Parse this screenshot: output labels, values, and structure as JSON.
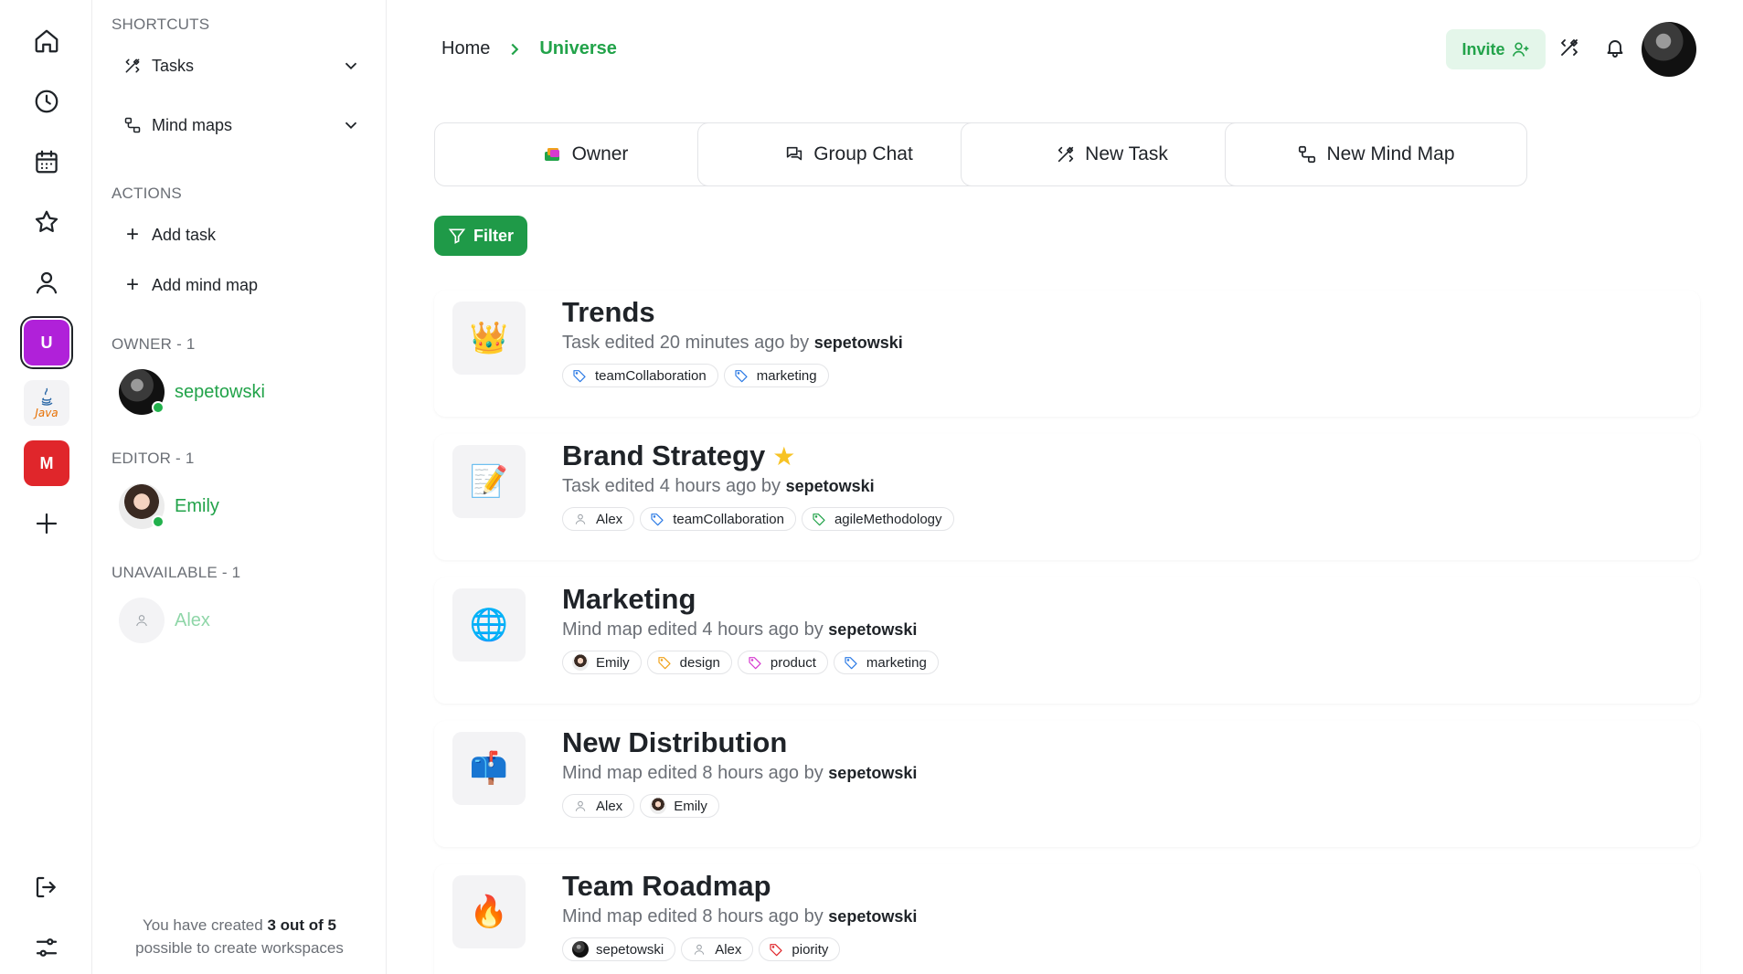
{
  "rail": {
    "nav_icons": [
      "home-icon",
      "clock-icon",
      "calendar-icon",
      "star-icon",
      "user-icon"
    ],
    "workspaces": [
      {
        "label": "U",
        "color": "#b021d9"
      },
      {
        "label": "Java",
        "color": "#e76f00"
      },
      {
        "label": "M",
        "color": "#e0262b"
      }
    ],
    "add_label": "+"
  },
  "sidebar": {
    "shortcuts_title": "SHORTCUTS",
    "shortcuts": [
      {
        "label": "Tasks",
        "icon": "tasks-icon"
      },
      {
        "label": "Mind maps",
        "icon": "mindmap-icon"
      }
    ],
    "actions_title": "ACTIONS",
    "actions": [
      {
        "label": "Add task",
        "icon": "plus-icon"
      },
      {
        "label": "Add mind map",
        "icon": "plus-icon"
      }
    ],
    "owner_title": "OWNER - 1",
    "owner": {
      "name": "sepetowski",
      "status": "online"
    },
    "editor_title": "EDITOR - 1",
    "editor": {
      "name": "Emily",
      "status": "online"
    },
    "unavailable_title": "UNAVAILABLE - 1",
    "unavailable": {
      "name": "Alex",
      "status": "offline"
    },
    "footer": {
      "prefix": "You have created ",
      "count": "3 out of 5",
      "suffix": "possible to create workspaces"
    }
  },
  "header": {
    "breadcrumb": {
      "home": "Home",
      "current": "Universe"
    },
    "invite_label": "Invite",
    "accent": "#22a34a"
  },
  "quick_actions": [
    {
      "label": "Owner",
      "icon": "owner-icon"
    },
    {
      "label": "Group Chat",
      "icon": "chat-icon"
    },
    {
      "label": "New Task",
      "icon": "tasks-icon"
    },
    {
      "label": "New Mind Map",
      "icon": "mindmap-icon"
    }
  ],
  "filter_label": "Filter",
  "items": [
    {
      "title": "Trends",
      "emoji": "👑",
      "starred": false,
      "meta": "Task edited 20 minutes ago by ",
      "author": "sepetowski",
      "tags": [
        {
          "label": "teamCollaboration",
          "kind": "tag",
          "color": "#2d7be5"
        },
        {
          "label": "marketing",
          "kind": "tag",
          "color": "#2d7be5"
        }
      ]
    },
    {
      "title": "Brand Strategy",
      "emoji": "📝",
      "starred": true,
      "star_symbol": "★",
      "meta": "Task edited 4 hours ago by ",
      "author": "sepetowski",
      "tags": [
        {
          "label": "Alex",
          "kind": "user"
        },
        {
          "label": "teamCollaboration",
          "kind": "tag",
          "color": "#2d7be5"
        },
        {
          "label": "agileMethodology",
          "kind": "tag",
          "color": "#22a34a"
        }
      ]
    },
    {
      "title": "Marketing",
      "emoji": "🌐",
      "starred": false,
      "meta": "Mind map edited 4 hours ago by ",
      "author": "sepetowski",
      "tags": [
        {
          "label": "Emily",
          "kind": "emily"
        },
        {
          "label": "design",
          "kind": "tag",
          "color": "#f0a21a"
        },
        {
          "label": "product",
          "kind": "tag",
          "color": "#d63ad0"
        },
        {
          "label": "marketing",
          "kind": "tag",
          "color": "#2d7be5"
        }
      ]
    },
    {
      "title": "New Distribution",
      "emoji": "📫",
      "starred": false,
      "meta": "Mind map edited 8 hours ago by ",
      "author": "sepetowski",
      "tags": [
        {
          "label": "Alex",
          "kind": "user"
        },
        {
          "label": "Emily",
          "kind": "emily"
        }
      ]
    },
    {
      "title": "Team Roadmap",
      "emoji": "🔥",
      "starred": false,
      "meta": "Mind map edited 8 hours ago by ",
      "author": "sepetowski",
      "tags": [
        {
          "label": "sepetowski",
          "kind": "owner"
        },
        {
          "label": "Alex",
          "kind": "user"
        },
        {
          "label": "piority",
          "kind": "tag",
          "color": "#e0262b"
        }
      ]
    }
  ]
}
